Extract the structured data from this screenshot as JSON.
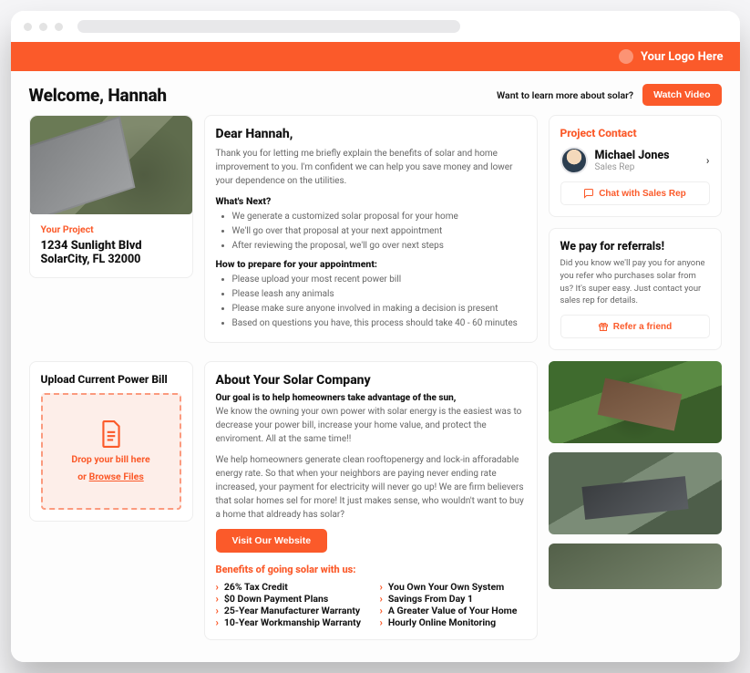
{
  "brand": {
    "logo_text": "Your Logo Here"
  },
  "header": {
    "welcome": "Welcome, Hannah",
    "learn_more": "Want to learn more about solar?",
    "watch_video": "Watch Video"
  },
  "project": {
    "label": "Your Project",
    "address1": "1234 Sunlight Blvd",
    "address2": "SolarCity, FL 32000"
  },
  "letter": {
    "greeting": "Dear Hannah,",
    "intro": "Thank you for letting me briefly explain the benefits of solar and home improvement to you. I'm confident we can help you save money and lower your dependence on the utilities.",
    "whats_next_title": "What's Next?",
    "whats_next": [
      "We generate a customized solar proposal for your home",
      "We'll go over that proposal at your next appointment",
      "After reviewing the proposal, we'll go over next steps"
    ],
    "prepare_title": "How to prepare for your appointment:",
    "prepare": [
      "Please upload your most recent power bill",
      "Please leash any animals",
      "Please make sure anyone involved in making a decision is present",
      "Based on questions you have, this process should take 40 - 60 minutes"
    ]
  },
  "contact": {
    "title": "Project Contact",
    "name": "Michael Jones",
    "role": "Sales Rep",
    "chat_label": "Chat with Sales Rep"
  },
  "referral": {
    "title": "We pay for referrals!",
    "body": "Did you know we'll pay you for anyone you refer who purchases solar from us? It's super easy. Just contact your sales rep for details.",
    "button": "Refer a friend"
  },
  "upload": {
    "title": "Upload Current Power Bill",
    "line1": "Drop your bill here",
    "line2_prefix": "or ",
    "line2_link": "Browse Files"
  },
  "about": {
    "title": "About Your Solar Company",
    "lead": "Our goal is to help homeowners take advantage of the sun,",
    "para1": "We know the owning your own power with solar energy is the easiest was to decrease your power bill, increase your home value, and protect the enviroment. All at the same time!!",
    "para2": "We help homeowners generate clean rooftopenergy and lock-in afforadable energy rate. So that when your neighbors are paying never ending rate increased, your payment for electricity will never go up! We are firm believers that solar homes sel for more! It just makes sense, who wouldn't want to buy a home that aldready has solar?",
    "visit_button": "Visit Our Website",
    "benefits_title": "Benefits of going solar with us:",
    "benefits_left": [
      "26% Tax Credit",
      "$0 Down Payment Plans",
      "25-Year Manufacturer Warranty",
      "10-Year Workmanship Warranty"
    ],
    "benefits_right": [
      "You Own Your Own System",
      "Savings From Day 1",
      "A Greater Value of Your Home",
      "Hourly Online Monitoring"
    ]
  }
}
